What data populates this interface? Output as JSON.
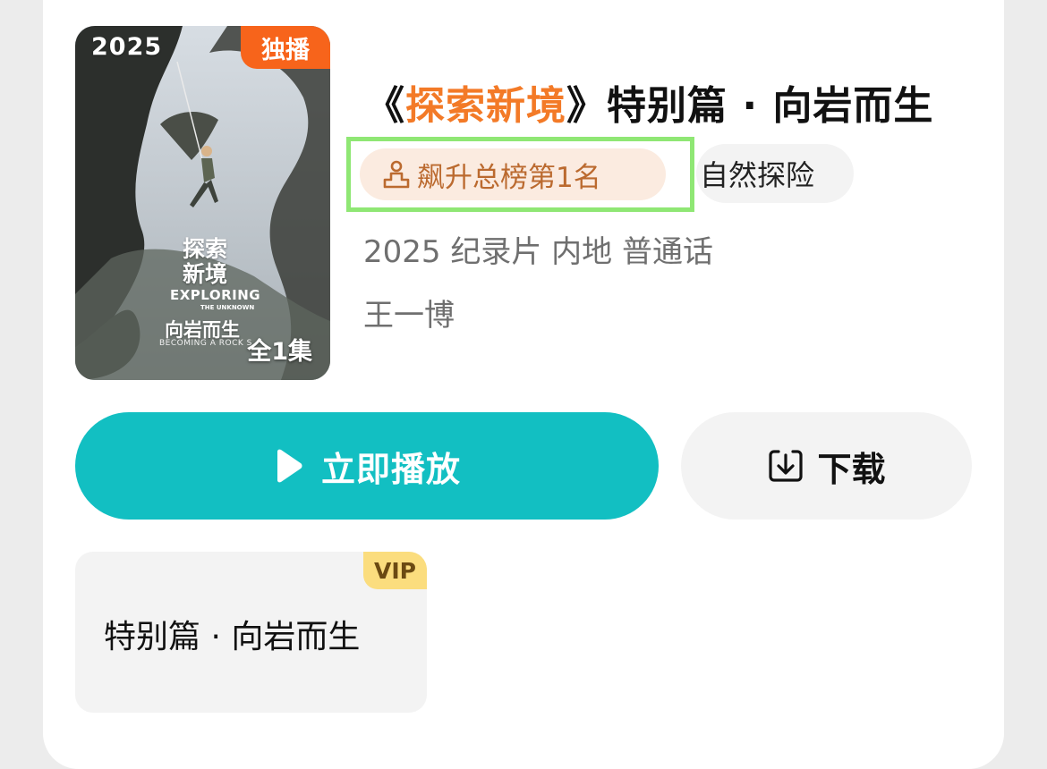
{
  "poster": {
    "year": "2025",
    "badge": "独播",
    "cn_title_line1": "探索",
    "cn_title_line2": "新境",
    "en_title": "EXPLORING",
    "en_sub": "THE UNKNOWN",
    "subtitle": "向岩而生",
    "subtitle_en": "BECOMING A ROCK S",
    "episodes": "全1集"
  },
  "title": {
    "open_bracket": "《",
    "highlight": "探索新境",
    "close_rest": "》特别篇 · 向岩而生"
  },
  "tags": {
    "rank": "飙升总榜第1名",
    "genre": "自然探险"
  },
  "meta": "2025 纪录片 内地 普通话",
  "cast": "王一博",
  "actions": {
    "play_label": "立即播放",
    "download_label": "下载"
  },
  "episode": {
    "badge": "VIP",
    "title": "特别篇 · 向岩而生"
  },
  "colors": {
    "accent_orange": "#f37a27",
    "play_button": "#12bfc2",
    "rank_tag_bg": "#fbebe0",
    "rank_tag_text": "#bb6a2f",
    "vip_badge": "#fbdd7e",
    "highlight_box": "#8fe774"
  },
  "icons": {
    "rank": "podium-icon",
    "play": "play-icon",
    "download": "download-icon"
  }
}
